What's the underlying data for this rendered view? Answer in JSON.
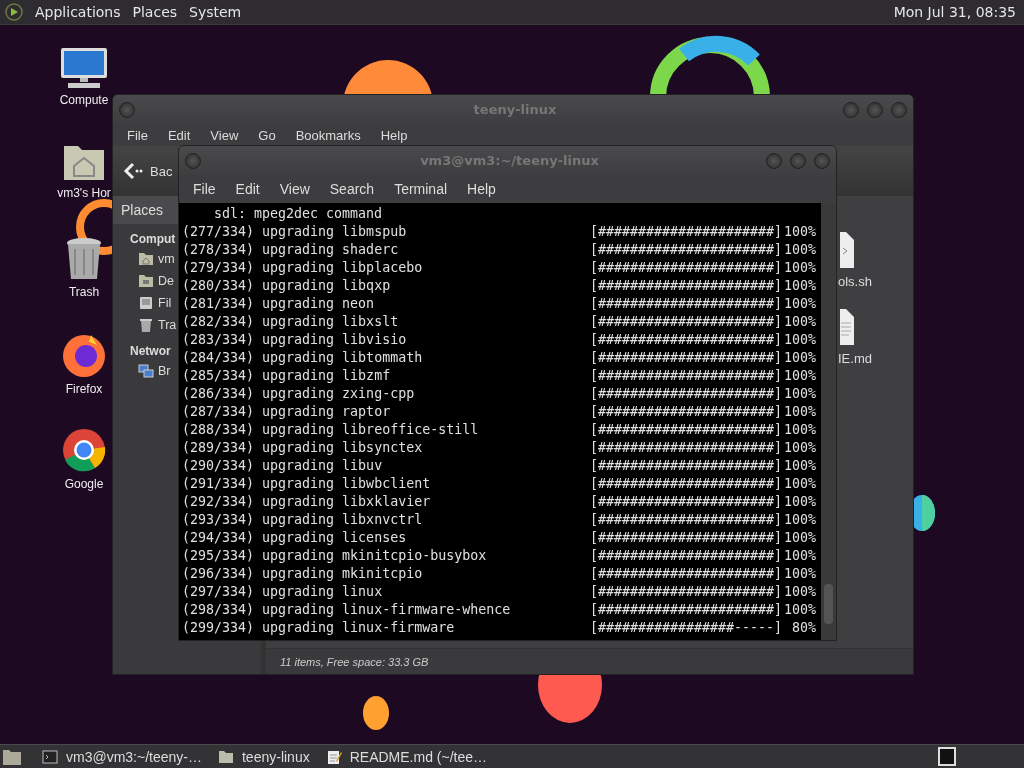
{
  "top_panel": {
    "menus": [
      "Applications",
      "Places",
      "System"
    ],
    "clock": "Mon Jul 31, 08:35"
  },
  "desktop_icons": [
    {
      "label": "Compute",
      "kind": "computer"
    },
    {
      "label": "vm3's Hor",
      "kind": "home"
    },
    {
      "label": "Trash",
      "kind": "trash"
    },
    {
      "label": "Firefox",
      "kind": "firefox"
    },
    {
      "label": "Google",
      "kind": "chrome"
    }
  ],
  "file_manager": {
    "title": "teeny-linux",
    "menu": [
      "File",
      "Edit",
      "View",
      "Go",
      "Bookmarks",
      "Help"
    ],
    "back_label": "Bac",
    "sidebar_tab": "Places",
    "sidebar": [
      {
        "heading": "Comput",
        "items": [
          {
            "label": "vm",
            "kind": "home"
          },
          {
            "label": "De",
            "kind": "desktop"
          },
          {
            "label": "Fil",
            "kind": "drive"
          },
          {
            "label": "Tra",
            "kind": "trash"
          }
        ]
      },
      {
        "heading": "Networ",
        "items": [
          {
            "label": "Br",
            "kind": "network"
          }
        ]
      }
    ],
    "files": [
      {
        "label": "ols.sh",
        "kind": "script"
      },
      {
        "label": "IE.md",
        "kind": "text"
      }
    ],
    "status": "11 items, Free space: 33.3 GB"
  },
  "terminal": {
    "title": "vm3@vm3:~/teeny-linux",
    "menu": [
      "File",
      "Edit",
      "View",
      "Search",
      "Terminal",
      "Help"
    ],
    "header_line": "sdl: mpeg2dec command",
    "lines": [
      {
        "text": "(277/334) upgrading libmspub",
        "bar": "[######################]",
        "percent": "100%"
      },
      {
        "text": "(278/334) upgrading shaderc",
        "bar": "[######################]",
        "percent": "100%"
      },
      {
        "text": "(279/334) upgrading libplacebo",
        "bar": "[######################]",
        "percent": "100%"
      },
      {
        "text": "(280/334) upgrading libqxp",
        "bar": "[######################]",
        "percent": "100%"
      },
      {
        "text": "(281/334) upgrading neon",
        "bar": "[######################]",
        "percent": "100%"
      },
      {
        "text": "(282/334) upgrading libxslt",
        "bar": "[######################]",
        "percent": "100%"
      },
      {
        "text": "(283/334) upgrading libvisio",
        "bar": "[######################]",
        "percent": "100%"
      },
      {
        "text": "(284/334) upgrading libtommath",
        "bar": "[######################]",
        "percent": "100%"
      },
      {
        "text": "(285/334) upgrading libzmf",
        "bar": "[######################]",
        "percent": "100%"
      },
      {
        "text": "(286/334) upgrading zxing-cpp",
        "bar": "[######################]",
        "percent": "100%"
      },
      {
        "text": "(287/334) upgrading raptor",
        "bar": "[######################]",
        "percent": "100%"
      },
      {
        "text": "(288/334) upgrading libreoffice-still",
        "bar": "[######################]",
        "percent": "100%"
      },
      {
        "text": "(289/334) upgrading libsynctex",
        "bar": "[######################]",
        "percent": "100%"
      },
      {
        "text": "(290/334) upgrading libuv",
        "bar": "[######################]",
        "percent": "100%"
      },
      {
        "text": "(291/334) upgrading libwbclient",
        "bar": "[######################]",
        "percent": "100%"
      },
      {
        "text": "(292/334) upgrading libxklavier",
        "bar": "[######################]",
        "percent": "100%"
      },
      {
        "text": "(293/334) upgrading libxnvctrl",
        "bar": "[######################]",
        "percent": "100%"
      },
      {
        "text": "(294/334) upgrading licenses",
        "bar": "[######################]",
        "percent": "100%"
      },
      {
        "text": "(295/334) upgrading mkinitcpio-busybox",
        "bar": "[######################]",
        "percent": "100%"
      },
      {
        "text": "(296/334) upgrading mkinitcpio",
        "bar": "[######################]",
        "percent": "100%"
      },
      {
        "text": "(297/334) upgrading linux",
        "bar": "[######################]",
        "percent": "100%"
      },
      {
        "text": "(298/334) upgrading linux-firmware-whence",
        "bar": "[######################]",
        "percent": "100%"
      },
      {
        "text": "(299/334) upgrading linux-firmware",
        "bar": "[#################-----]",
        "percent": "80%"
      }
    ]
  },
  "taskbar": {
    "items": [
      {
        "label": "vm3@vm3:~/teeny-…",
        "kind": "terminal"
      },
      {
        "label": "teeny-linux",
        "kind": "folder"
      },
      {
        "label": "README.md (~/tee…",
        "kind": "editor"
      }
    ]
  }
}
